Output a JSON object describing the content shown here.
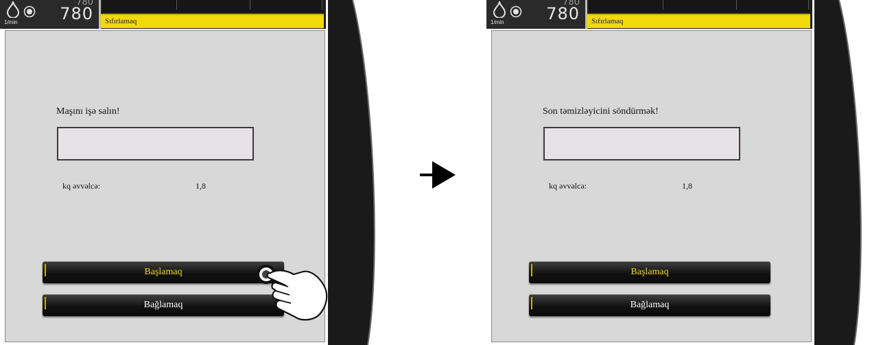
{
  "colors": {
    "accent_yellow": "#f2d90a",
    "screen_gray": "#d8d8d8",
    "button_dark": "#111111",
    "rim": "#1a1a1a"
  },
  "panels": [
    {
      "unit": "1/min",
      "speed_small": "780",
      "speed_big": "780",
      "reset_label": "Sıfırlamaq",
      "message": "Maşını işə salın!",
      "row_label": "kq əvvəlcə:",
      "row_value": "1,8",
      "start_label": "Başlamaq",
      "close_label": "Bağlamaq"
    },
    {
      "unit": "1/min",
      "speed_small": "780",
      "speed_big": "780",
      "reset_label": "Sıfırlamaq",
      "message": "Son təmizləyicini söndürmək!",
      "row_label": "kq əvvəlcə:",
      "row_value": "1,8",
      "start_label": "Başlamaq",
      "close_label": "Bağlamaq"
    }
  ],
  "icons": [
    "drop-icon",
    "target-icon",
    "arrow-right-icon",
    "pointing-hand-icon"
  ]
}
